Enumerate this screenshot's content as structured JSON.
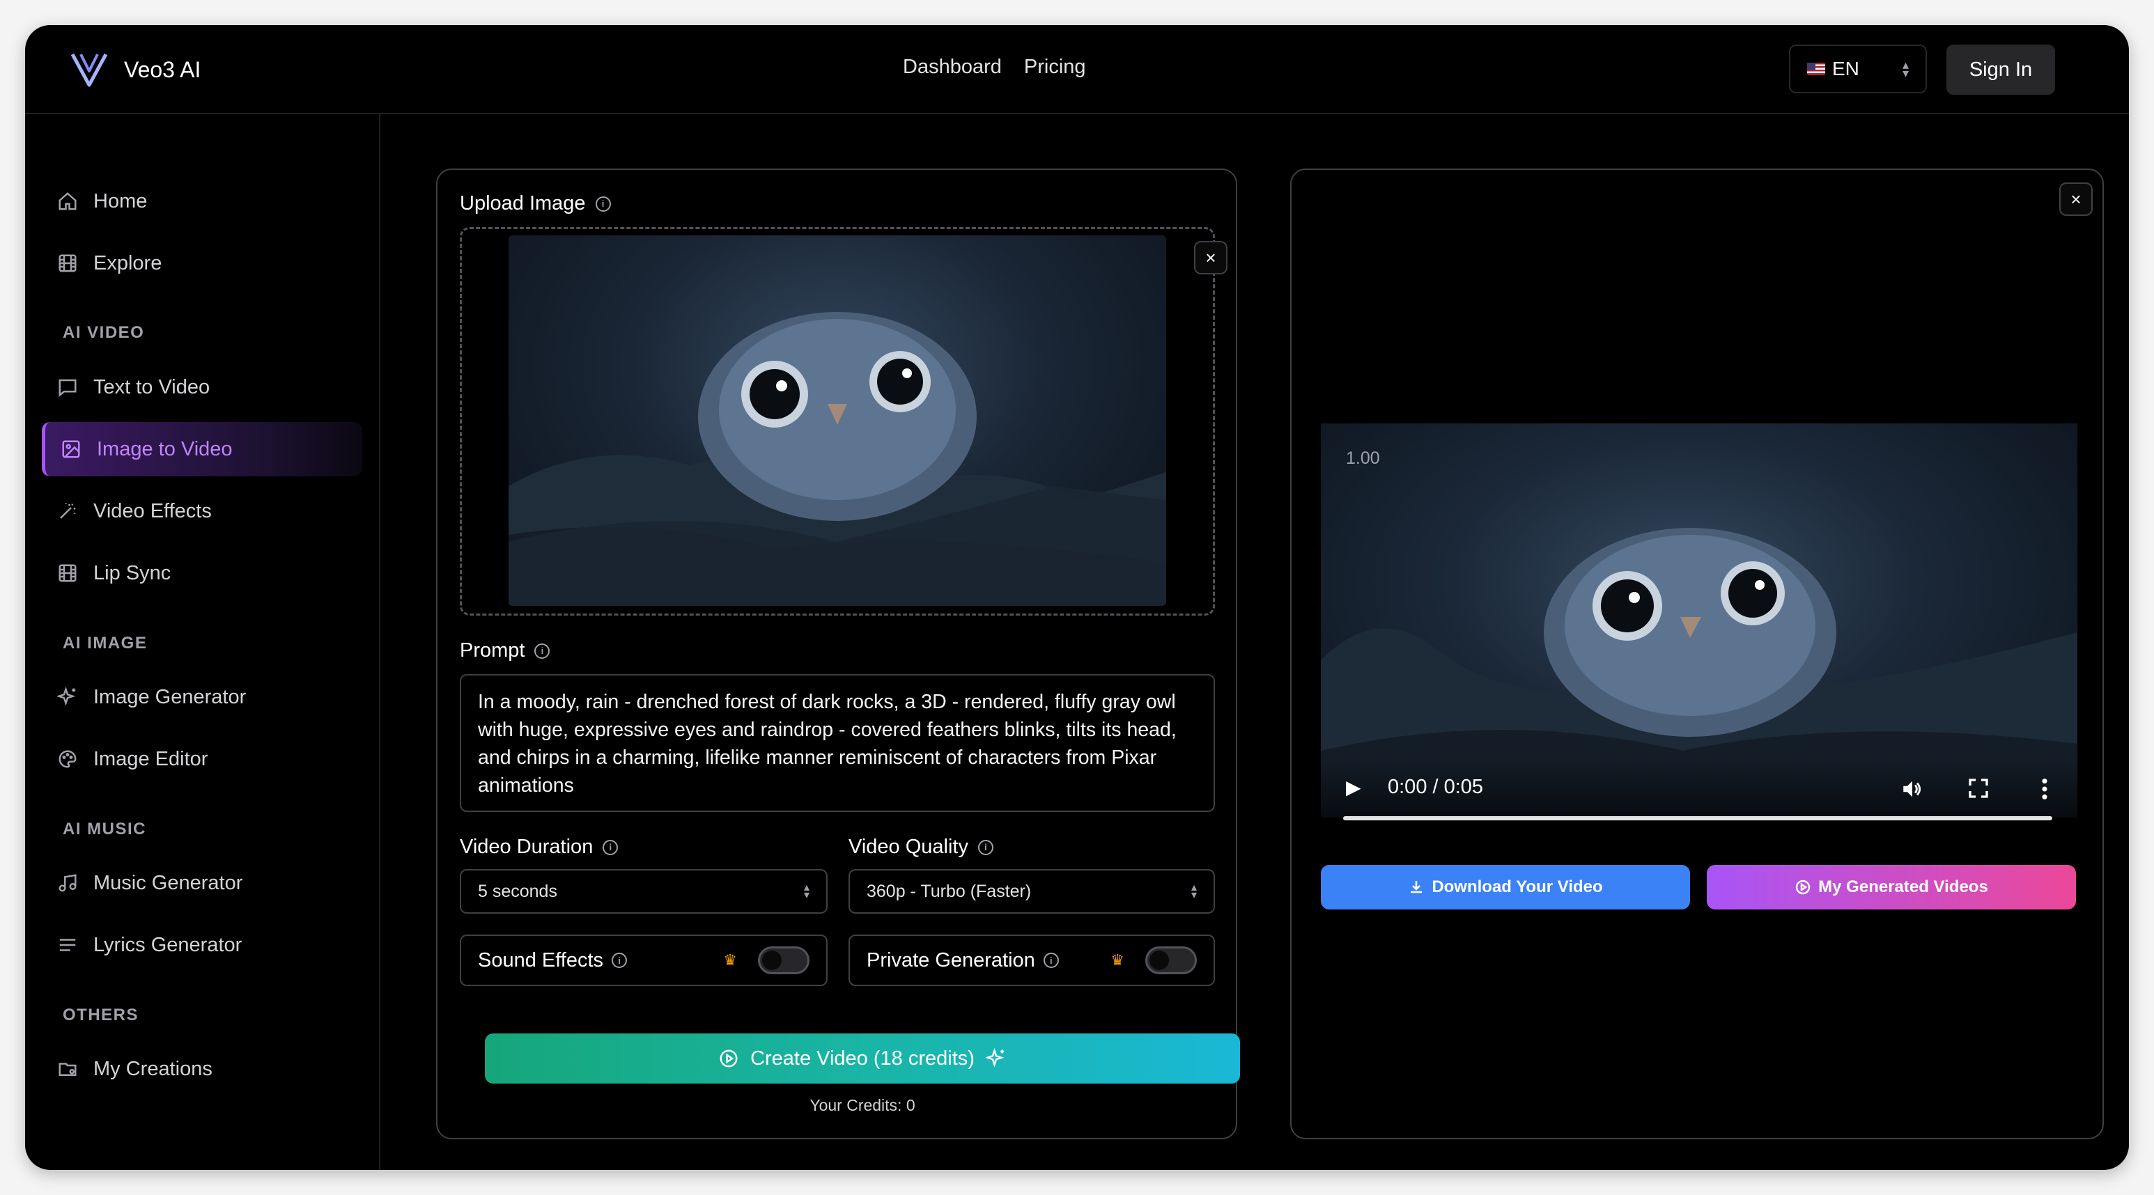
{
  "app": {
    "name": "Veo3 AI"
  },
  "nav": {
    "dashboard": "Dashboard",
    "pricing": "Pricing"
  },
  "lang": {
    "value": "EN"
  },
  "auth": {
    "sign_in": "Sign In"
  },
  "sidebar": {
    "home": "Home",
    "explore": "Explore",
    "section_video": "AI VIDEO",
    "text_to_video": "Text to Video",
    "image_to_video": "Image to Video",
    "video_effects": "Video Effects",
    "lip_sync": "Lip Sync",
    "section_image": "AI IMAGE",
    "image_generator": "Image Generator",
    "image_editor": "Image Editor",
    "section_music": "AI MUSIC",
    "music_generator": "Music Generator",
    "lyrics_generator": "Lyrics Generator",
    "section_others": "OTHERS",
    "my_creations": "My Creations"
  },
  "form": {
    "upload_label": "Upload Image",
    "prompt_label": "Prompt",
    "prompt_value": "In a moody, rain - drenched forest of dark rocks, a 3D - rendered, fluffy gray owl with huge, expressive eyes and raindrop - covered feathers blinks, tilts its head, and chirps in a charming, lifelike manner reminiscent of characters from Pixar animations",
    "duration_label": "Video Duration",
    "duration_value": "5 seconds",
    "quality_label": "Video Quality",
    "quality_value": "360p - Turbo (Faster)",
    "sound_effects": "Sound Effects",
    "private_generation": "Private Generation",
    "create_button": "Create Video (18 credits)",
    "credits_text": "Your Credits: 0"
  },
  "preview": {
    "watermark": "1.00",
    "time": "0:00 / 0:05",
    "download_button": "Download Your Video",
    "my_videos_button": "My Generated Videos"
  },
  "colors": {
    "accent_purple": "#a855f7",
    "create_gradient_start": "#16a67a",
    "create_gradient_end": "#1ab8d6",
    "download_blue": "#3b82f6",
    "my_videos_gradient_start": "#a855f7",
    "my_videos_gradient_end": "#ec4899",
    "crown": "#f59e0b"
  }
}
